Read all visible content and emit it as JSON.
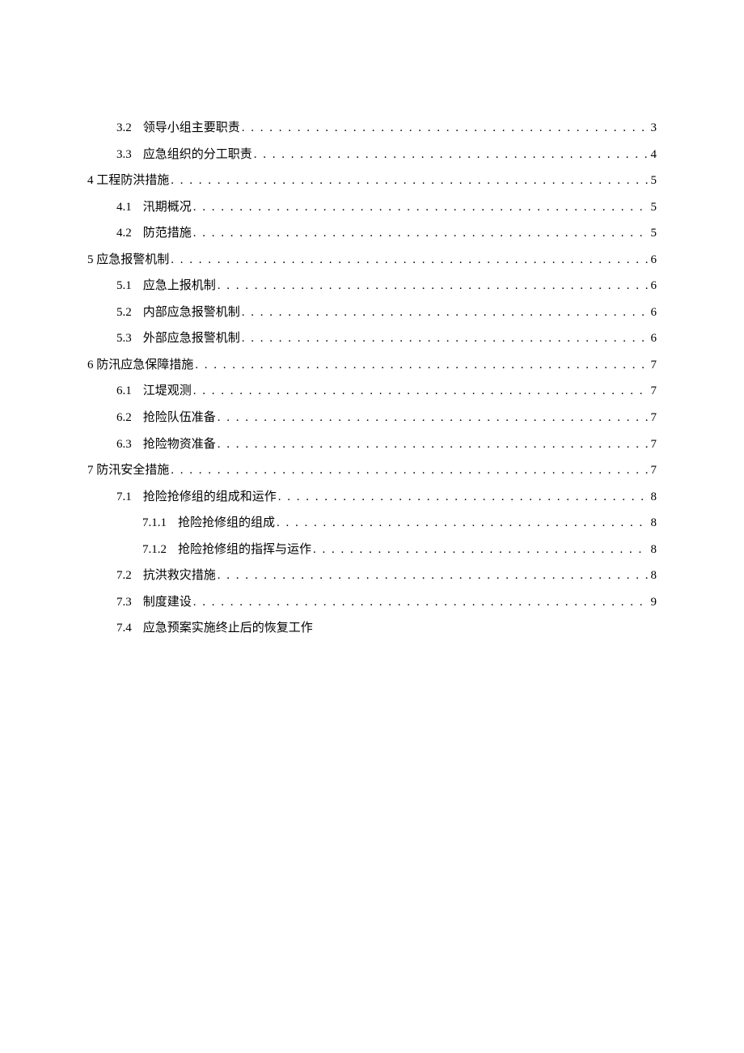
{
  "toc": [
    {
      "level": 1,
      "num": "3.2",
      "title": "领导小组主要职责",
      "page": "3",
      "hasPage": true
    },
    {
      "level": 1,
      "num": "3.3",
      "title": "应急组织的分工职责",
      "page": "4",
      "hasPage": true
    },
    {
      "level": 0,
      "num": "4",
      "title": "工程防洪措施",
      "page": "5",
      "hasPage": true,
      "joinNum": true
    },
    {
      "level": 1,
      "num": "4.1",
      "title": "汛期概况",
      "page": "5",
      "hasPage": true
    },
    {
      "level": 1,
      "num": "4.2",
      "title": "防范措施",
      "page": "5",
      "hasPage": true
    },
    {
      "level": 0,
      "num": "5",
      "title": "应急报警机制",
      "page": "6",
      "hasPage": true,
      "joinNum": true
    },
    {
      "level": 1,
      "num": "5.1",
      "title": "应急上报机制",
      "page": "6",
      "hasPage": true
    },
    {
      "level": 1,
      "num": "5.2",
      "title": "内部应急报警机制",
      "page": "6",
      "hasPage": true
    },
    {
      "level": 1,
      "num": "5.3",
      "title": "外部应急报警机制",
      "page": "6",
      "hasPage": true
    },
    {
      "level": 0,
      "num": "6",
      "title": "防汛应急保障措施",
      "page": "7",
      "hasPage": true,
      "joinNum": true
    },
    {
      "level": 1,
      "num": "6.1",
      "title": "江堤观测",
      "page": "7",
      "hasPage": true
    },
    {
      "level": 1,
      "num": "6.2",
      "title": "抢险队伍准备",
      "page": "7",
      "hasPage": true
    },
    {
      "level": 1,
      "num": "6.3",
      "title": "抢险物资准备",
      "page": "7",
      "hasPage": true
    },
    {
      "level": 0,
      "num": "7",
      "title": "防汛安全措施",
      "page": "7",
      "hasPage": true,
      "joinNum": true
    },
    {
      "level": 1,
      "num": "7.1",
      "title": "抢险抢修组的组成和运作",
      "page": "8",
      "hasPage": true
    },
    {
      "level": 2,
      "num": "7.1.1",
      "title": "抢险抢修组的组成",
      "page": "8",
      "hasPage": true
    },
    {
      "level": 2,
      "num": "7.1.2",
      "title": "抢险抢修组的指挥与运作",
      "page": "8",
      "hasPage": true
    },
    {
      "level": 1,
      "num": "7.2",
      "title": "抗洪救灾措施",
      "page": "8",
      "hasPage": true
    },
    {
      "level": 1,
      "num": "7.3",
      "title": "制度建设",
      "page": "9",
      "hasPage": true
    },
    {
      "level": 1,
      "num": "7.4",
      "title": "应急预案实施终止后的恢复工作",
      "page": "",
      "hasPage": false
    }
  ]
}
